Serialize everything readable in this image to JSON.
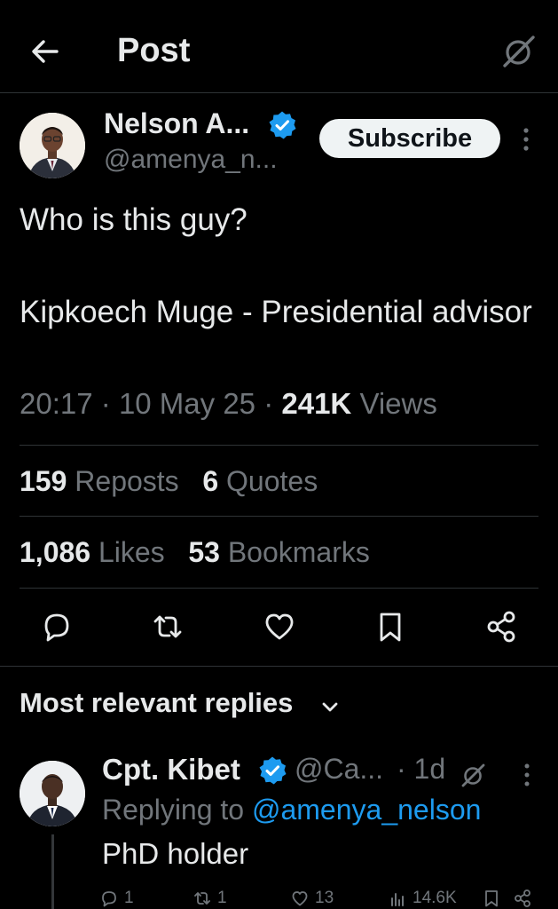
{
  "header": {
    "title": "Post",
    "back_icon": "arrow-left-icon",
    "grok_icon": "grok-icon"
  },
  "post": {
    "author_name": "Nelson A...",
    "author_handle": "@amenya_n...",
    "subscribe_label": "Subscribe",
    "text": "Who is this guy?\n\nKipkoech Muge - Presidential advisor",
    "time": "20:17",
    "date": "10 May 25",
    "views_count": "241K",
    "views_label": "Views",
    "separator": "·"
  },
  "stats": {
    "reposts": {
      "count": "159",
      "label": "Reposts"
    },
    "quotes": {
      "count": "6",
      "label": "Quotes"
    },
    "likes": {
      "count": "1,086",
      "label": "Likes"
    },
    "bookmarks": {
      "count": "53",
      "label": "Bookmarks"
    }
  },
  "actions": [
    "reply-icon",
    "repost-icon",
    "like-icon",
    "bookmark-icon",
    "share-icon"
  ],
  "replies_section": {
    "label": "Most relevant replies"
  },
  "reply": {
    "name": "Cpt. Kibet",
    "handle": "@Ca...",
    "time": "· 1d",
    "replying_prefix": "Replying to",
    "replying_handle": "@amenya_nelson",
    "text": "PhD holder",
    "reply_count": "1",
    "repost_count": "1",
    "like_count": "13",
    "view_count": "14.6K"
  },
  "colors": {
    "background": "#000000",
    "text": "#e7e9ea",
    "muted": "#71767b",
    "accent": "#1d9bf0",
    "divider": "#2f3336"
  }
}
